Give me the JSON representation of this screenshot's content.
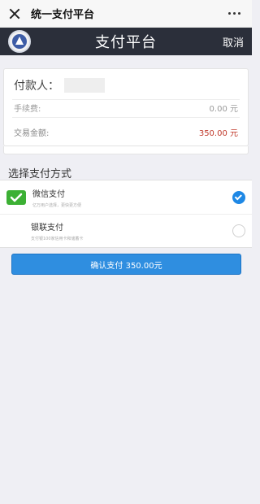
{
  "wx_bar": {
    "title": "统一支付平台"
  },
  "header": {
    "title": "支付平台",
    "cancel_label": "取消"
  },
  "info": {
    "payer_label": "付款人：",
    "fee_label": "手续费:",
    "fee_value": "0.00 元",
    "amount_label": "交易金额:",
    "amount_value": "350.00 元"
  },
  "section_title": "选择支付方式",
  "methods": [
    {
      "name": "微信支付",
      "desc": "亿万用户选择，更快更方便",
      "icon": "wechat-pay-icon",
      "selected": true
    },
    {
      "name": "银联支付",
      "desc": "支付银100家信用卡和储蓄卡",
      "icon": "unionpay-icon",
      "selected": false
    }
  ],
  "confirm_label": "确认支付 350.00元",
  "colors": {
    "header_bg": "#2b2f3a",
    "accent": "#2f8ee0",
    "amount": "#c0392b",
    "wechat": "#3cb034"
  }
}
